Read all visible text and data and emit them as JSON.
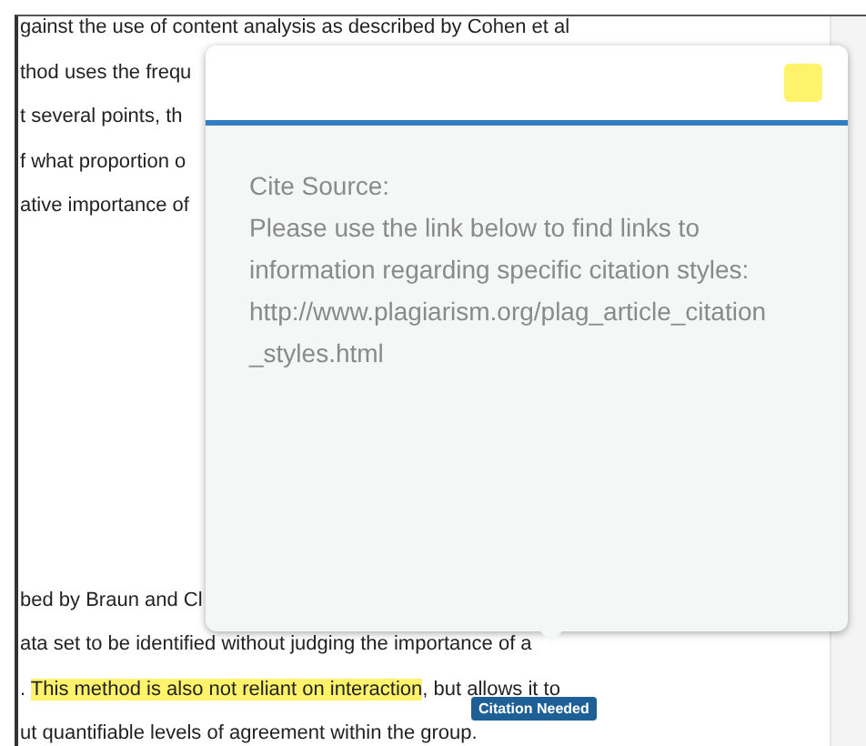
{
  "document": {
    "upper_lines": [
      "gainst the use of content analysis as described by Cohen et al",
      "thod uses the frequ",
      "t several points, th",
      "f what proportion o",
      "ative importance of"
    ],
    "lower_lines": [
      {
        "segments": [
          {
            "text": "bed by Braun and Cl",
            "highlighted": false
          }
        ]
      },
      {
        "segments": [
          {
            "text": "ata set to be identified without judging the importance of a",
            "highlighted": false
          }
        ]
      },
      {
        "segments": [
          {
            "text": ". ",
            "highlighted": false
          },
          {
            "text": "This method is also not reliant on interaction",
            "highlighted": true
          },
          {
            "text": ", but allows it to",
            "highlighted": false
          }
        ]
      },
      {
        "segments": [
          {
            "text": "ut quantifiable levels of agreement within the group.",
            "highlighted": false
          }
        ]
      }
    ]
  },
  "popup": {
    "heading": "Cite Source:",
    "message": "Please use the link below to find links to information regarding specific citation styles:",
    "url": "http://www.plagiarism.org/plag_article_citation_styles.html"
  },
  "badge": {
    "label": "Citation Needed"
  }
}
